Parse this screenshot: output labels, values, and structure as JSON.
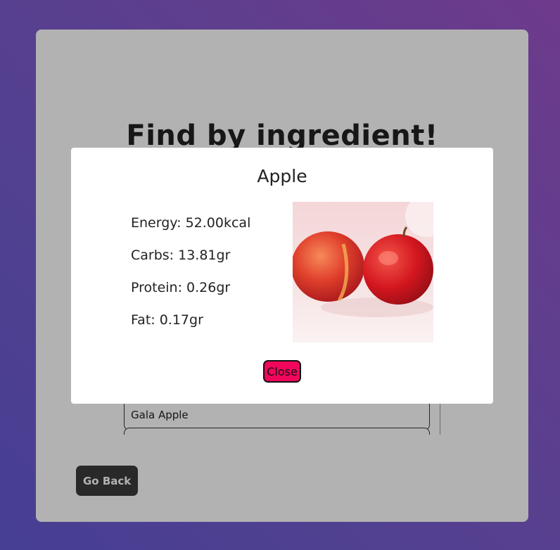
{
  "page": {
    "title": "Find by ingredient!",
    "go_back_label": "Go Back"
  },
  "results": {
    "items": [
      "Gala Apple",
      ""
    ]
  },
  "modal": {
    "title": "Apple",
    "energy": "Energy: 52.00kcal",
    "carbs": "Carbs: 13.81gr",
    "protein": "Protein: 0.26gr",
    "fat": "Fat: 0.17gr",
    "close_label": "Close",
    "image_icon": "apple-photo"
  },
  "colors": {
    "close_button": "#f0075c",
    "go_back_button": "#3b3b3b",
    "background_start": "#6e3a8c",
    "background_end": "#463f93"
  }
}
